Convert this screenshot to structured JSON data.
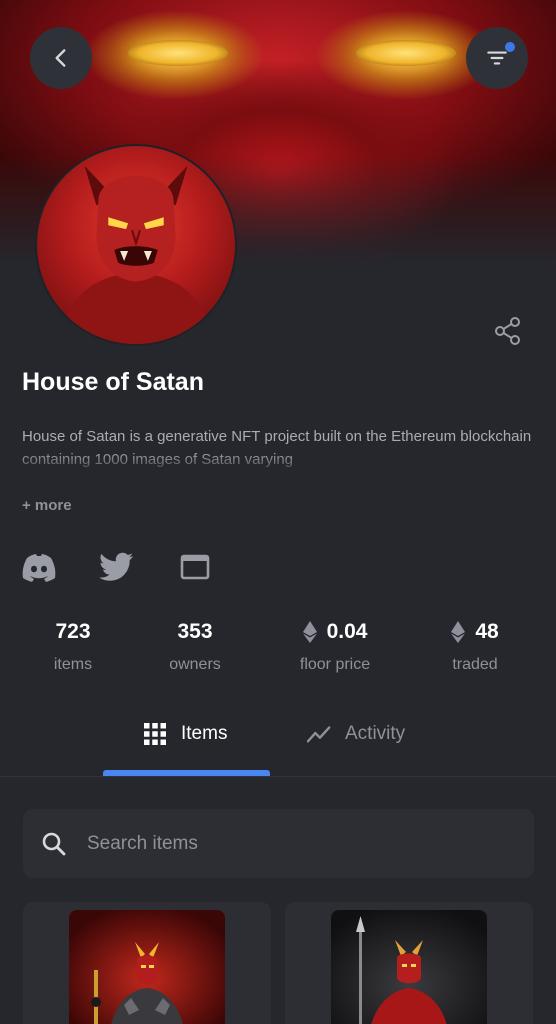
{
  "header": {
    "back_icon": "chevron-left-icon",
    "filter_icon": "filter-icon",
    "filter_indicator_color": "#3d78e8"
  },
  "collection": {
    "name": "House of Satan",
    "description": "House of Satan is a generative NFT project built on the Ethereum blockchain containing 1000 images of Satan varying",
    "more_label": "+ more",
    "share_icon": "share-icon"
  },
  "social_links": [
    {
      "icon": "discord-icon"
    },
    {
      "icon": "twitter-icon"
    },
    {
      "icon": "website-icon"
    }
  ],
  "stats": [
    {
      "value": "723",
      "label": "items",
      "currency_icon": ""
    },
    {
      "value": "353",
      "label": "owners",
      "currency_icon": ""
    },
    {
      "value": "0.04",
      "label": "floor price",
      "currency_icon": "ethereum-icon"
    },
    {
      "value": "48",
      "label": "traded",
      "currency_icon": "ethereum-icon"
    }
  ],
  "tabs": [
    {
      "label": "Items",
      "icon": "grid-icon",
      "active": true
    },
    {
      "label": "Activity",
      "icon": "trend-line-icon",
      "active": false
    }
  ],
  "search": {
    "placeholder": "Search items",
    "value": ""
  },
  "colors": {
    "background": "#25272d",
    "accent": "#4a86f0",
    "muted_text": "#8e9199"
  }
}
